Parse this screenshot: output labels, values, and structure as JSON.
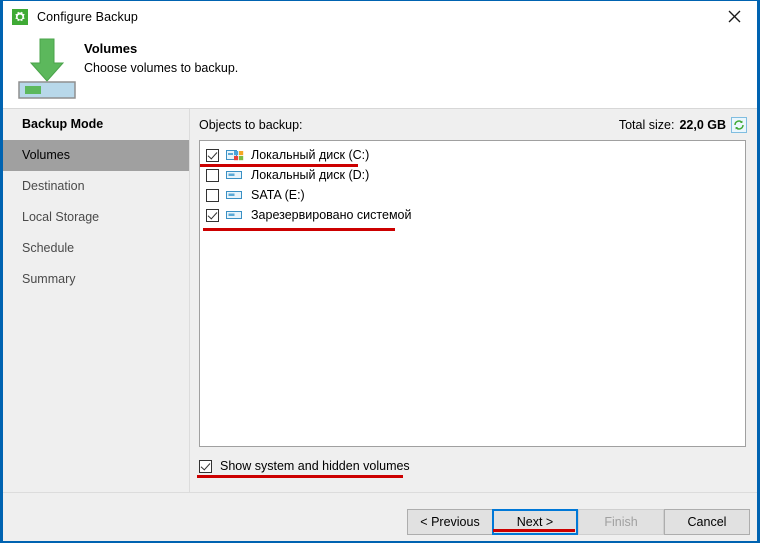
{
  "window": {
    "title": "Configure Backup",
    "title_icon": "gear-icon",
    "close_icon": "close-icon",
    "accent_color": "#0063b1"
  },
  "header": {
    "title": "Volumes",
    "subtitle": "Choose volumes to backup.",
    "icon": "green-down-arrow-volume-icon"
  },
  "sidebar": {
    "items": [
      {
        "label": "Backup Mode",
        "state": "visited"
      },
      {
        "label": "Volumes",
        "state": "active"
      },
      {
        "label": "Destination",
        "state": "normal"
      },
      {
        "label": "Local Storage",
        "state": "normal"
      },
      {
        "label": "Schedule",
        "state": "normal"
      },
      {
        "label": "Summary",
        "state": "normal"
      }
    ]
  },
  "main": {
    "objects_label": "Objects to backup:",
    "total_size_label": "Total size:",
    "total_size_value": "22,0 GB",
    "refresh_icon": "refresh-icon",
    "volumes": [
      {
        "label": "Локальный диск (C:)",
        "checked": true,
        "icon": "windows-system-drive-icon"
      },
      {
        "label": "Локальный диск (D:)",
        "checked": false,
        "icon": "drive-icon"
      },
      {
        "label": "SATA (E:)",
        "checked": false,
        "icon": "drive-icon"
      },
      {
        "label": "Зарезервировано системой",
        "checked": true,
        "icon": "drive-icon"
      }
    ],
    "show_system_label": "Show system and hidden volumes",
    "show_system_checked": true
  },
  "footer": {
    "buttons": [
      {
        "label": "< Previous",
        "state": "normal"
      },
      {
        "label": "Next >",
        "state": "default"
      },
      {
        "label": "Finish",
        "state": "disabled"
      },
      {
        "label": "Cancel",
        "state": "normal"
      }
    ]
  },
  "annotations": {
    "color": "#cc0000",
    "marks": [
      {
        "name": "underline-volume-c"
      },
      {
        "name": "underline-volume-system-reserved"
      },
      {
        "name": "underline-show-system-checkbox"
      },
      {
        "name": "underline-next-button"
      }
    ]
  }
}
